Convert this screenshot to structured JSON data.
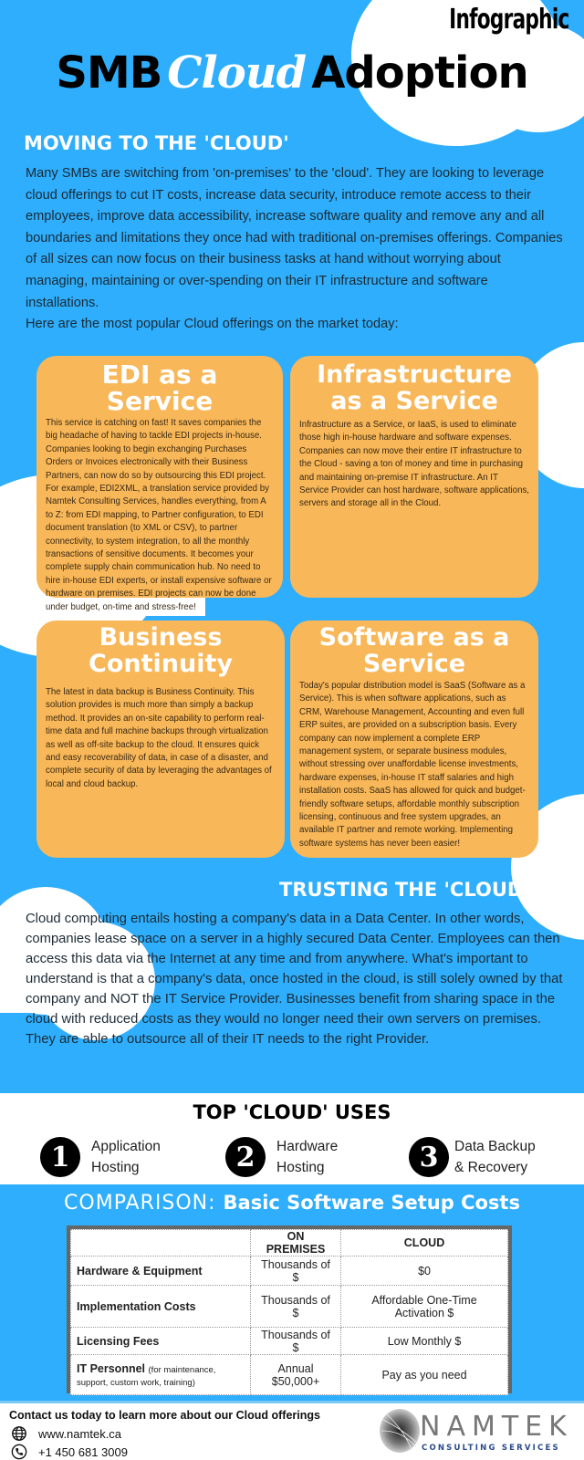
{
  "header": {
    "label": "Infographic",
    "title_part1": "SMB",
    "title_part2": "Cloud",
    "title_part3": "Adoption"
  },
  "moving": {
    "heading": "MOVING TO THE 'CLOUD'",
    "paragraph": "Many SMBs are switching from 'on-premises' to the 'cloud'. They are looking to leverage cloud offerings to cut IT costs, increase data security, introduce remote access to their employees, improve data accessibility, increase software quality and remove any and all boundaries and limitations they once had with traditional on-premises offerings. Companies of all sizes can now focus on their business tasks at hand without worrying about managing, maintaining or over-spending on their IT infrastructure and software installations.",
    "intro": "Here are the most popular Cloud offerings on the market today:"
  },
  "cards": [
    {
      "title": "EDI as a Service",
      "body": "This service is catching on fast! It saves companies the big headache of having to tackle EDI projects in-house. Companies looking to begin exchanging Purchases Orders or Invoices electronically with their Business Partners, can now do so by outsourcing this EDI project. For example, EDI2XML, a translation service provided by Namtek Consulting Services, handles everything, from A to Z: from EDI mapping, to Partner configuration, to EDI document translation (to XML or CSV), to partner connectivity, to system integration, to all the monthly transactions of sensitive documents. It becomes your complete supply chain communication hub. No need to hire in-house EDI experts, or install expensive software or hardware on premises. EDI projects can now be done under budget, on-time and stress-free!"
    },
    {
      "title": "Infrastructure as a Service",
      "body": "Infrastructure as a Service, or IaaS, is used to eliminate those high in-house hardware and software expenses. Companies can now move their entire IT infrastructure to the Cloud - saving a ton of money and time in purchasing and maintaining on-premise IT infrastructure. An IT Service Provider can host hardware, software applications, servers and storage all in the Cloud."
    },
    {
      "title": "Business Continuity",
      "body": "The latest in data backup is Business Continuity. This solution provides is much more than simply a backup method. It provides an on-site capability to perform real-time data and full machine backups through virtualization as well as off-site backup to the cloud. It ensures quick and easy recoverability of data, in case of a disaster, and complete security of data by leveraging the advantages of local and cloud backup."
    },
    {
      "title": "Software as a Service",
      "body": "Today's popular distribution model is SaaS (Software as a Service). This is when software applications, such as CRM, Warehouse Management, Accounting and even full ERP suites, are provided on a subscription basis. Every company can now implement a complete ERP management system, or separate business modules, without stressing over unaffordable license investments, hardware expenses, in-house IT staff salaries and high installation costs. SaaS has allowed for quick and budget-friendly software setups, affordable monthly subscription licensing, continuous and free system upgrades, an available IT partner and remote working. Implementing software systems has never been easier!"
    }
  ],
  "trusting": {
    "heading": "TRUSTING THE 'CLOUD'",
    "paragraph": "Cloud computing entails hosting a company's data in a Data Center. In other words, companies lease space on a server in a highly secured Data Center. Employees can then access this data via the Internet at any time and from anywhere. What's important to understand is that a company's data, once hosted in the cloud, is still solely owned by that company and NOT the IT Service Provider. Businesses benefit from sharing space in the cloud with reduced costs as they would no longer need their own servers on premises. They are able to outsource all of their IT needs to the right Provider."
  },
  "top_uses": {
    "heading": "TOP 'CLOUD' USES",
    "items": [
      {
        "number": "1",
        "line1": "Application",
        "line2": "Hosting"
      },
      {
        "number": "2",
        "line1": "Hardware",
        "line2": "Hosting"
      },
      {
        "number": "3",
        "line1": "Data Backup",
        "line2": "& Recovery"
      }
    ]
  },
  "comparison": {
    "label": "COMPARISON:",
    "title": "Basic Software Setup Costs",
    "columns": [
      "",
      "ON PREMISES",
      "CLOUD"
    ],
    "rows": [
      {
        "item": "Hardware & Equipment",
        "note": "",
        "on_premises": "Thousands of $",
        "cloud": "$0"
      },
      {
        "item": "Implementation Costs",
        "note": "",
        "on_premises": "Thousands of $",
        "cloud": "Affordable One-Time Activation $"
      },
      {
        "item": "Licensing Fees",
        "note": "",
        "on_premises": "Thousands of $",
        "cloud": "Low Monthly $"
      },
      {
        "item": "IT Personnel",
        "note": "(for maintenance, support, custom work, training)",
        "on_premises": "Annual $50,000+",
        "cloud": "Pay as you need"
      }
    ]
  },
  "footer": {
    "contact": "Contact us today to learn more about our Cloud offerings",
    "website": "www.namtek.ca",
    "phone": "+1 450 681 3009",
    "website_icon": "globe-icon",
    "phone_icon": "phone-icon",
    "logo_name": "NAMTEK",
    "logo_sub": "CONSULTING SERVICES"
  },
  "colors": {
    "background_blue": "#2eaefc",
    "card_orange": "#f8b758",
    "white": "#ffffff",
    "black": "#000000"
  }
}
